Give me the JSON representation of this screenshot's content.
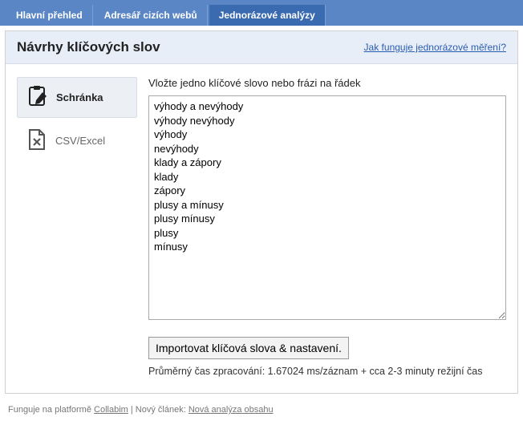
{
  "nav": {
    "tabs": [
      {
        "label": "Hlavní přehled",
        "active": false
      },
      {
        "label": "Adresář cizích webů",
        "active": false
      },
      {
        "label": "Jednorázové analýzy",
        "active": true
      }
    ]
  },
  "header": {
    "title": "Návrhy klíčových slov",
    "help_link": "Jak funguje jednorázové měření?"
  },
  "sidebar": {
    "items": [
      {
        "label": "Schránka",
        "icon": "clipboard-edit-icon",
        "active": true
      },
      {
        "label": "CSV/Excel",
        "icon": "file-x-icon",
        "active": false
      }
    ]
  },
  "form": {
    "prompt": "Vložte jedno klíčové slovo nebo frázi na řádek",
    "textarea_value": "výhody a nevýhody\nvýhody nevýhody\nvýhody\nnevýhody\nklady a zápory\nklady\nzápory\nplusy a mínusy\nplusy mínusy\nplusy\nmínusy",
    "submit_label": "Importovat klíčová slova & nastavení.",
    "processing_info": "Průměrný čas zpracování: 1.67024 ms/záznam + cca 2-3 minuty režijní čas"
  },
  "footer": {
    "prefix": "Funguje na platformě ",
    "platform_link": "Collabim",
    "separator": " | Nový článek: ",
    "article_link": "Nová analýza obsahu"
  }
}
